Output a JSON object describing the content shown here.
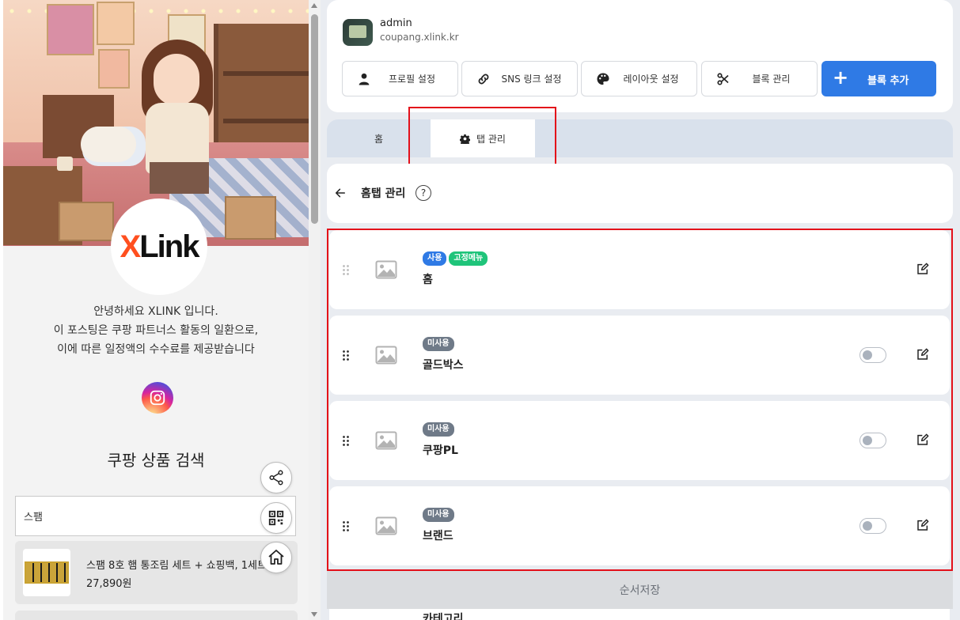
{
  "preview": {
    "logo": "XLink",
    "intro_lines": [
      "안녕하세요 XLINK 입니다.",
      "이 포스팅은 쿠팡 파트너스 활동의 일환으로,",
      "이에 따른 일정액의 수수료를 제공받습니다"
    ],
    "social_icon": "instagram-icon",
    "search_title": "쿠팡 상품 검색",
    "search_value": "스팸",
    "product": {
      "name": "스팸 8호 햄 통조림 세트 + 쇼핑백, 1세트",
      "price": "27,890원"
    },
    "float_buttons": [
      "share-icon",
      "qr-code-icon",
      "home-icon"
    ]
  },
  "profile": {
    "name": "admin",
    "domain": "coupang.xlink.kr"
  },
  "toolbar": {
    "profile_settings": "프로필 설정",
    "sns_links": "SNS 링크 설정",
    "layout_settings": "레이아웃 설정",
    "block_manage": "블록 관리",
    "add_block": "블록 추가"
  },
  "tabs": {
    "home": "홈",
    "manage": "탭 관리"
  },
  "section": {
    "title": "홈탭 관리",
    "help": "?"
  },
  "rows": [
    {
      "badges": [
        "사용",
        "고정메뉴"
      ],
      "name": "홈",
      "toggle": false
    },
    {
      "badges": [
        "미사용"
      ],
      "name": "골드박스",
      "toggle": false
    },
    {
      "badges": [
        "미사용"
      ],
      "name": "쿠팡PL",
      "toggle": false
    },
    {
      "badges": [
        "미사용"
      ],
      "name": "브랜드",
      "toggle": false
    }
  ],
  "save_label": "순서저장",
  "peek_row_name": "카테고리",
  "colors": {
    "accent": "#2f7ae5",
    "badge_fixed": "#1fc47a",
    "badge_off": "#6f7a88",
    "highlight": "#e3101a"
  }
}
